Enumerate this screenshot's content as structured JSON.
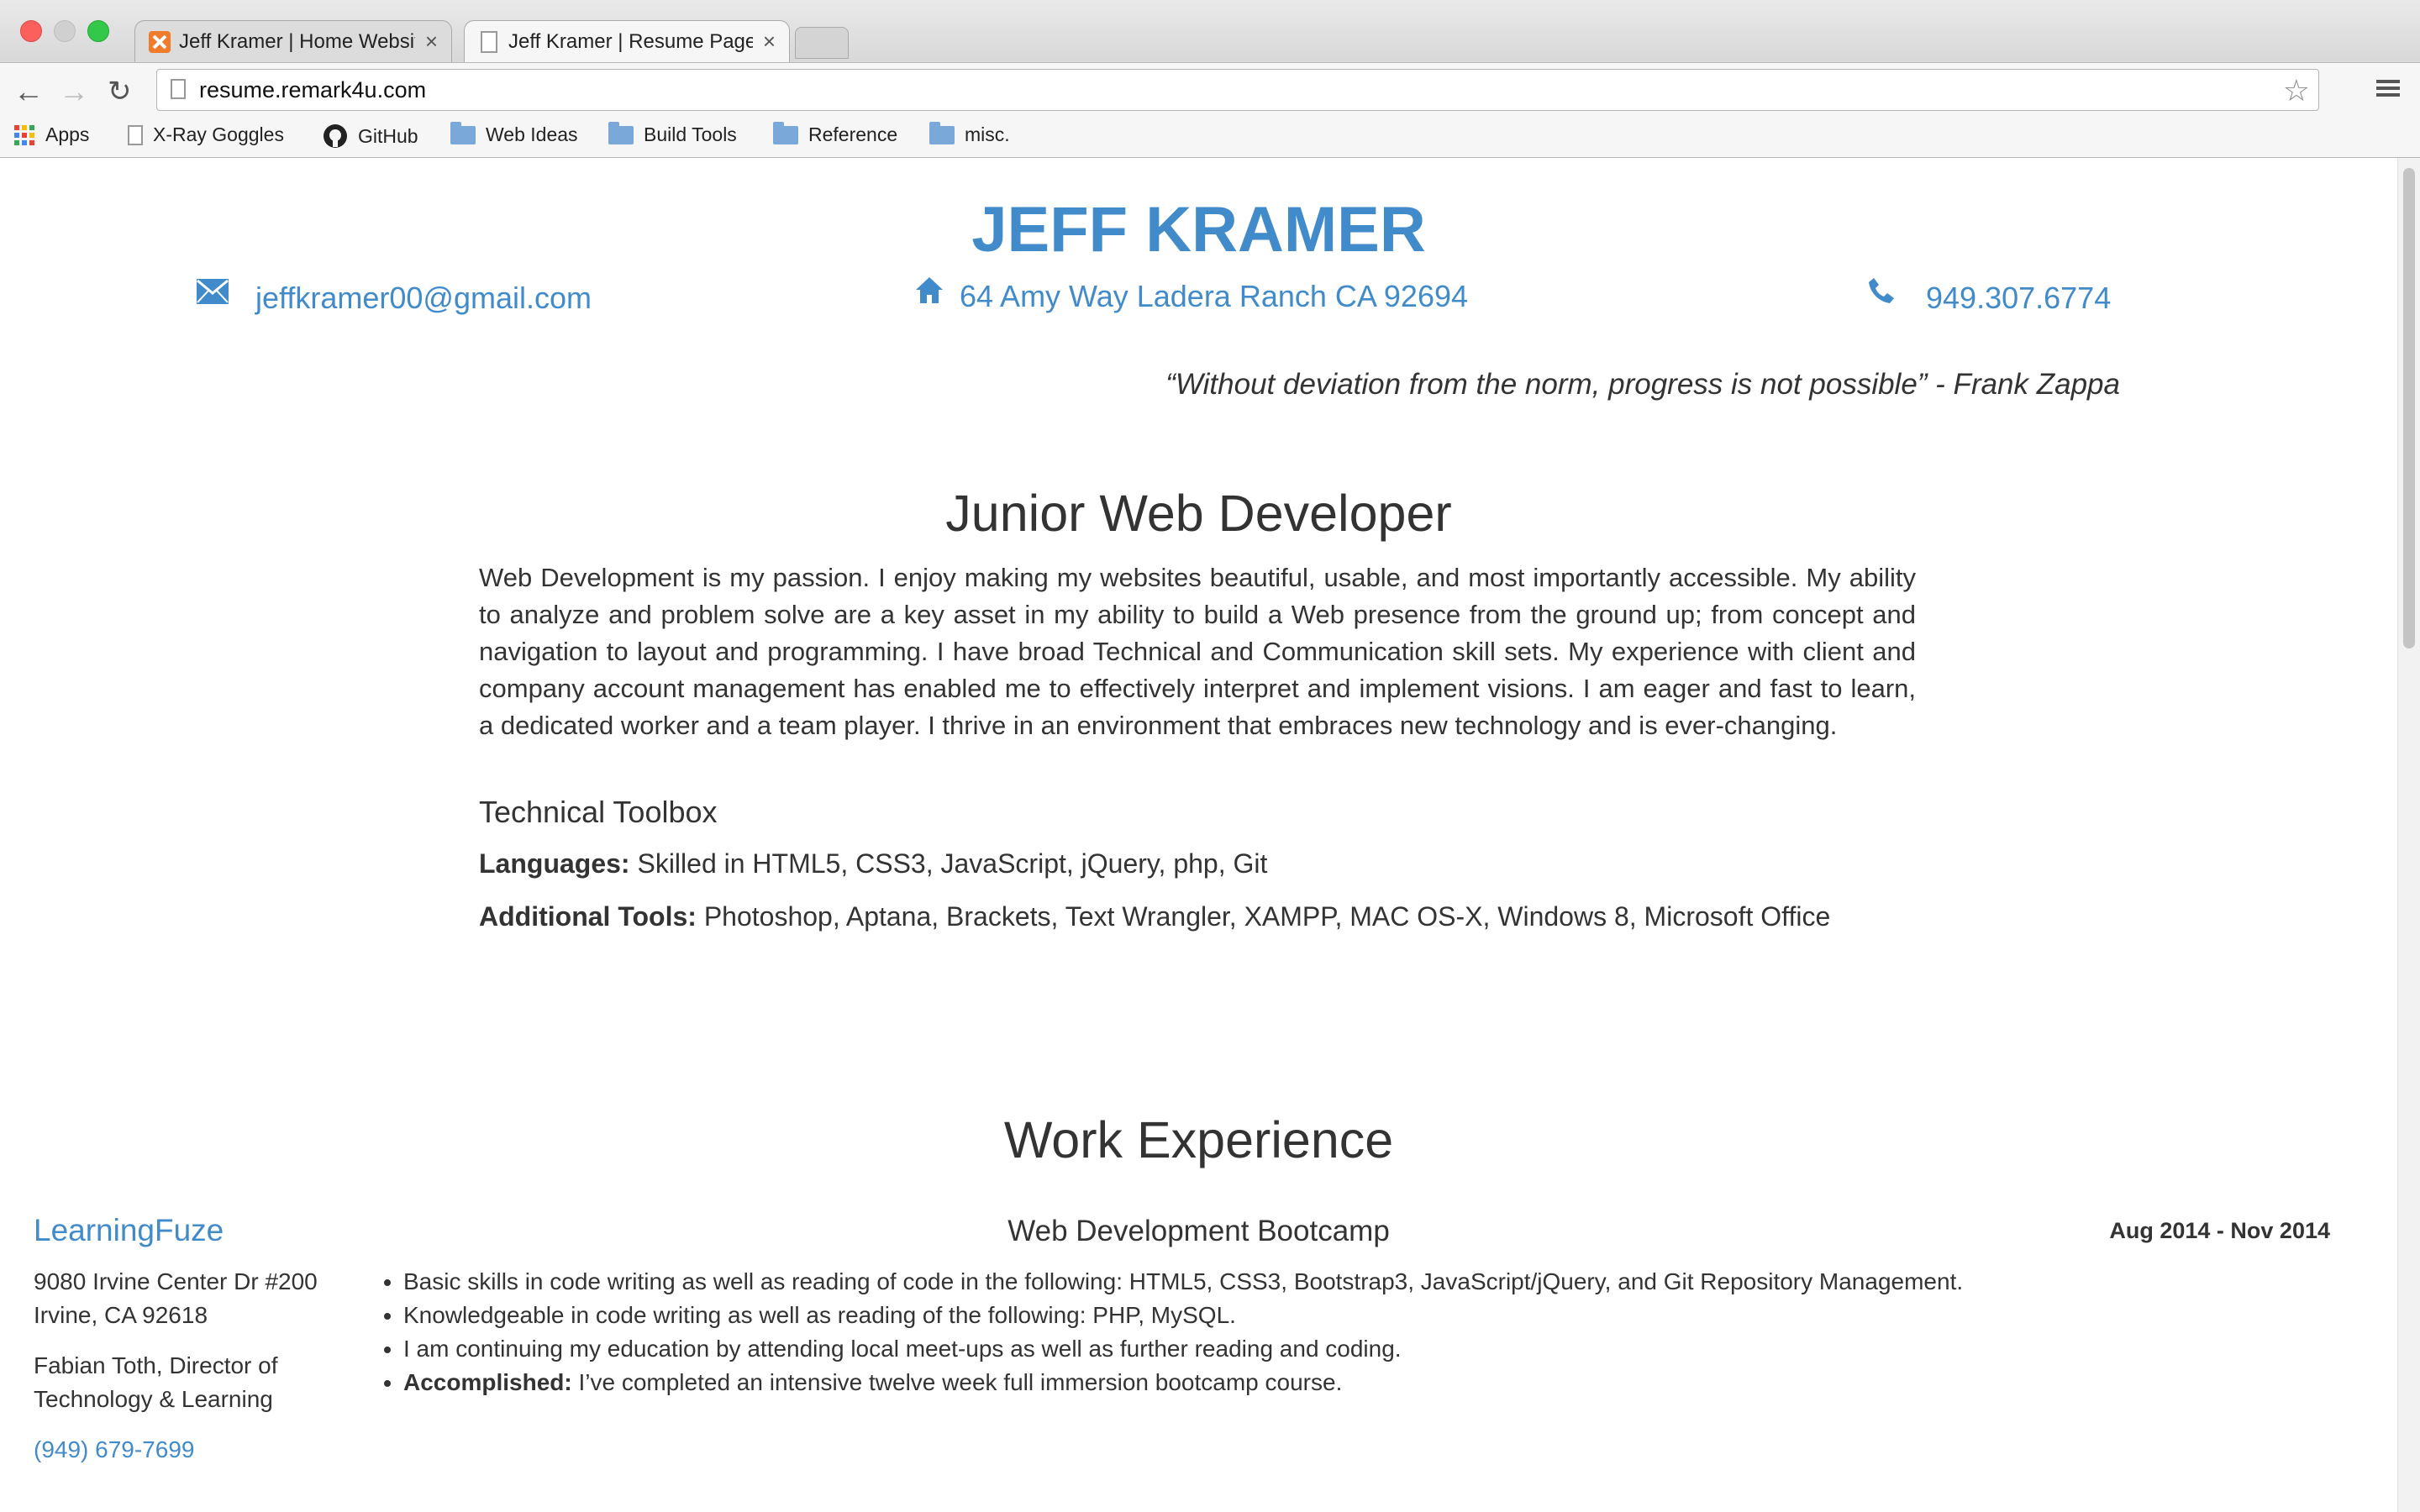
{
  "browser": {
    "tabs": [
      {
        "title": "Jeff Kramer | Home Website",
        "active": false,
        "icon": "xampp-icon"
      },
      {
        "title": "Jeff Kramer | Resume Page",
        "active": true,
        "icon": "document-icon"
      }
    ],
    "tab_close_glyph": "×",
    "url": "resume.remark4u.com",
    "bookmarks": [
      {
        "label": "Apps",
        "icon": "apps-grid-icon"
      },
      {
        "label": "X-Ray Goggles",
        "icon": "document-icon"
      },
      {
        "label": "GitHub",
        "icon": "github-icon"
      },
      {
        "label": "Web Ideas",
        "icon": "folder-icon"
      },
      {
        "label": "Build Tools",
        "icon": "folder-icon"
      },
      {
        "label": "Reference",
        "icon": "folder-icon"
      },
      {
        "label": "misc.",
        "icon": "folder-icon"
      }
    ]
  },
  "header": {
    "name": "JEFF KRAMER",
    "email": "jeffkramer00@gmail.com",
    "address": "64 Amy Way Ladera Ranch CA 92694",
    "phone": "949.307.6774",
    "quote": "“Without deviation from the norm, progress is not possible” - Frank Zappa"
  },
  "summary": {
    "title": "Junior Web Developer",
    "body": "Web Development is my passion. I enjoy making my websites beautiful, usable, and most importantly accessible. My ability to analyze and problem solve are a key asset in my ability to build a Web presence from the ground up; from concept and navigation to layout and programming. I have broad Technical and Communication skill sets. My experience with client and company account management has enabled me to effectively interpret and implement visions. I am eager and fast to learn, a dedicated worker and a team player. I thrive in an environment that embraces new technology and is ever-changing.",
    "toolbox_title": "Technical Toolbox",
    "languages_label": "Languages:",
    "languages_value": "Skilled in HTML5, CSS3, JavaScript, jQuery, php, Git",
    "tools_label": "Additional Tools:",
    "tools_value": "Photoshop, Aptana, Brackets, Text Wrangler, XAMPP, MAC OS-X, Windows 8, Microsoft Office"
  },
  "work": {
    "title": "Work Experience",
    "jobs": [
      {
        "company": "LearningFuze",
        "address_line1": "9080 Irvine Center Dr #200",
        "address_line2": "Irvine, CA 92618",
        "contact_line1": "Fabian Toth, Director of",
        "contact_line2": "Technology & Learning",
        "phone": "(949) 679-7699",
        "role": "Web Development Bootcamp",
        "dates": "Aug 2014 - Nov 2014",
        "bullets": [
          "Basic skills in code writing as well as reading of code in the following: HTML5, CSS3, Bootstrap3, JavaScript/jQuery, and Git Repository Management.",
          "Knowledgeable in code writing as well as reading of the following: PHP, MySQL.",
          "I am continuing my education by attending local meet-ups as well as further reading and coding."
        ],
        "accomplished_label": "Accomplished:",
        "accomplished_text": "I’ve completed an intensive twelve week full immersion bootcamp course."
      }
    ]
  },
  "colors": {
    "accent": "#428bca",
    "text": "#333333"
  }
}
